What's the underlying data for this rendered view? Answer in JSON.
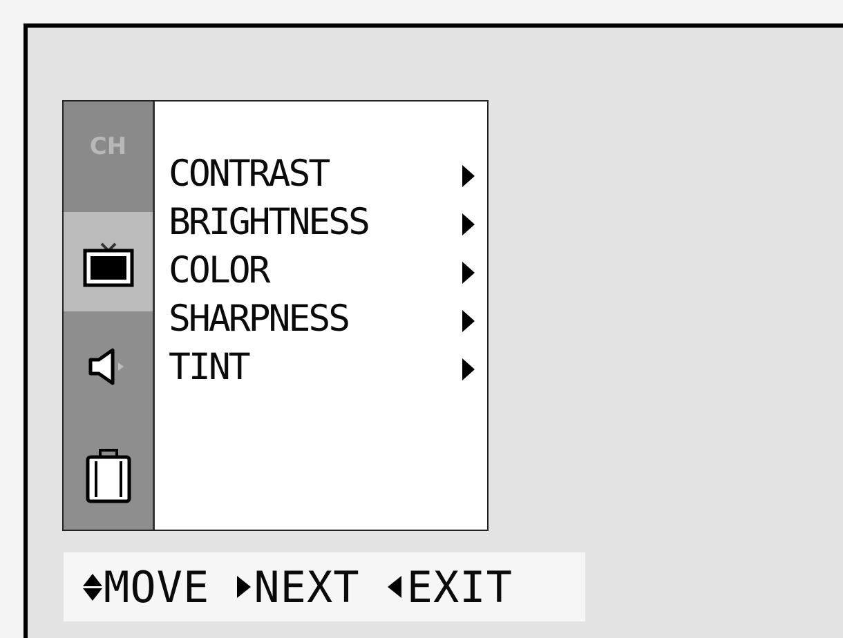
{
  "osd": {
    "tabs": [
      {
        "label": "CH",
        "icon": "channel-icon"
      },
      {
        "label": "",
        "icon": "tv-icon"
      },
      {
        "label": "",
        "icon": "speaker-icon"
      },
      {
        "label": "",
        "icon": "case-icon"
      }
    ],
    "menu_items": [
      {
        "label": "CONTRAST"
      },
      {
        "label": "BRIGHTNESS"
      },
      {
        "label": "COLOR"
      },
      {
        "label": "SHARPNESS"
      },
      {
        "label": "TINT"
      }
    ]
  },
  "footer": {
    "move": "MOVE",
    "next": "NEXT",
    "exit": "EXIT"
  },
  "colors": {
    "screen_bg": "#e3e3e3",
    "sidebar_bg": "#8e8e8e",
    "selected_tab_bg": "#bcbcbc",
    "menu_bg": "#ffffff",
    "text": "#0a0a0a"
  }
}
